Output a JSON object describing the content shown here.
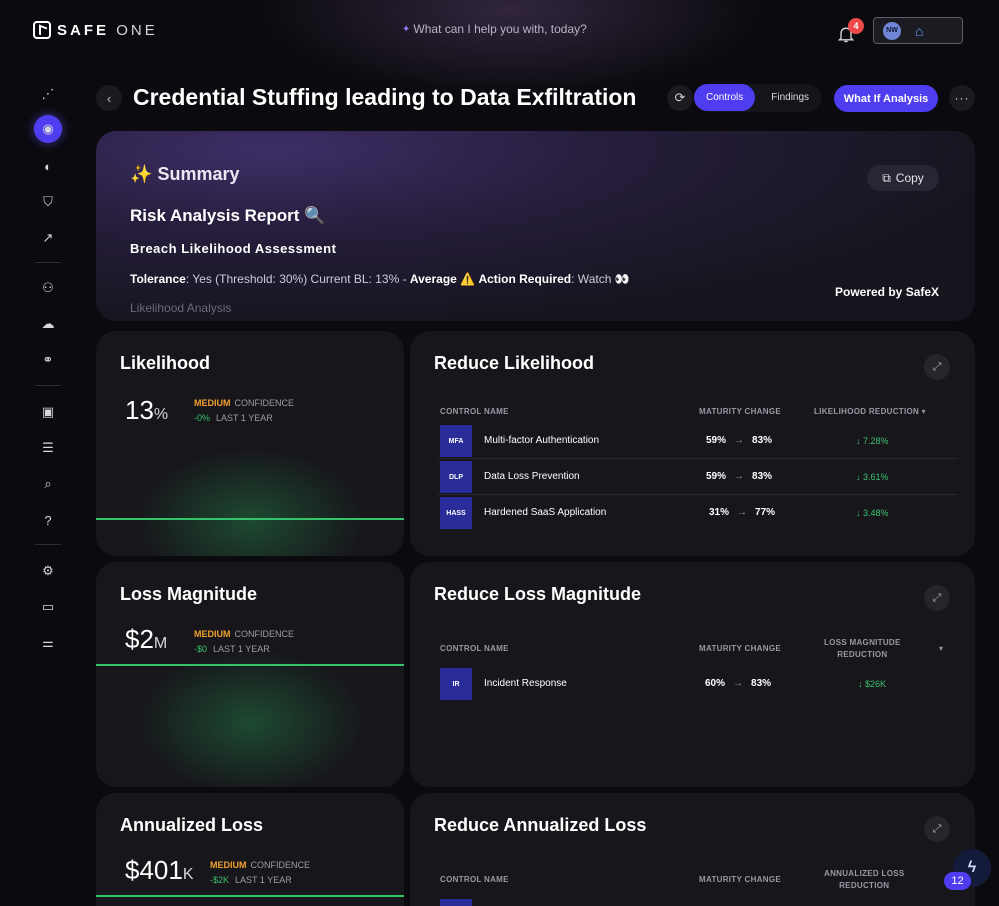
{
  "brand": {
    "name_bold": "SAFE",
    "name_thin": "ONE"
  },
  "assistant": {
    "prompt": "What can I help you with, today?"
  },
  "notifications": {
    "count": "4"
  },
  "user": {
    "initials": "NW"
  },
  "page": {
    "title": "Credential Stuffing leading to Data Exfiltration",
    "tabs": [
      {
        "label": "Controls"
      },
      {
        "label": "Findings"
      }
    ],
    "whatif_label": "What If Analysis",
    "more_label": "···"
  },
  "summary": {
    "title": "Summary",
    "copy_label": "Copy",
    "report_title": "Risk Analysis Report 🔍",
    "breach_title": "Breach Likelihood Assessment",
    "tolerance_label": "Tolerance",
    "tolerance_text": ": Yes (Threshold: 30%) Current BL: 13% - ",
    "average_text": "Average ⚠️",
    "action_label": "Action Required",
    "action_text": ": Watch 👀",
    "likelihood_analysis": "Likelihood Analysis",
    "powered_by": "Powered by SafeX"
  },
  "metrics": {
    "likelihood": {
      "title": "Likelihood",
      "value": "13",
      "unit": "%",
      "confidence_level": "MEDIUM",
      "confidence_label": "CONFIDENCE",
      "change": "-0%",
      "period": "LAST 1 YEAR"
    },
    "loss_magnitude": {
      "title": "Loss Magnitude",
      "value": "$2",
      "unit": "M",
      "confidence_level": "MEDIUM",
      "confidence_label": "CONFIDENCE",
      "change": "-$0",
      "period": "LAST 1 YEAR"
    },
    "annualized_loss": {
      "title": "Annualized Loss",
      "value": "$401",
      "unit": "K",
      "confidence_level": "MEDIUM",
      "confidence_label": "CONFIDENCE",
      "change": "-$2K",
      "period": "LAST 1 YEAR"
    }
  },
  "reduce": {
    "likelihood": {
      "title": "Reduce Likelihood",
      "headers": {
        "control": "CONTROL NAME",
        "maturity": "MATURITY CHANGE",
        "reduction": "LIKELIHOOD REDUCTION"
      },
      "rows": [
        {
          "badge": "MFA",
          "name": "Multi-factor Authentication",
          "from": "59%",
          "to": "83%",
          "reduction": "↓ 7.28%"
        },
        {
          "badge": "DLP",
          "name": "Data Loss Prevention",
          "from": "59%",
          "to": "83%",
          "reduction": "↓ 3.61%"
        },
        {
          "badge": "HASS",
          "name": "Hardened SaaS Application",
          "from": "31%",
          "to": "77%",
          "reduction": "↓ 3.48%"
        }
      ]
    },
    "loss_magnitude": {
      "title": "Reduce Loss Magnitude",
      "headers": {
        "control": "CONTROL NAME",
        "maturity": "MATURITY CHANGE",
        "reduction_line1": "LOSS MAGNITUDE",
        "reduction_line2": "REDUCTION"
      },
      "rows": [
        {
          "badge": "IR",
          "name": "Incident Response",
          "from": "60%",
          "to": "83%",
          "reduction": "↓ $26K"
        }
      ]
    },
    "annualized_loss": {
      "title": "Reduce Annualized Loss",
      "headers": {
        "control": "CONTROL NAME",
        "maturity": "MATURITY CHANGE",
        "reduction_line1": "ANNUALIZED LOSS",
        "reduction_line2": "REDUCTION"
      }
    }
  },
  "assistant_fab": {
    "count": "12"
  },
  "colors": {
    "accent": "#4f3df0",
    "positive": "#3bc26e",
    "warning": "#f0a030",
    "alert": "#ee4a4a",
    "card_bg": "#17161b"
  }
}
